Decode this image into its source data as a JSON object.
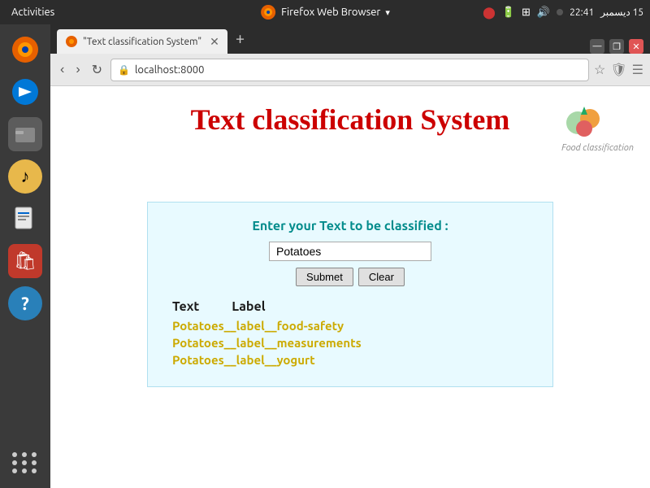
{
  "taskbar": {
    "activities_label": "Activities",
    "browser_label": "Firefox Web Browser",
    "time": "22:41",
    "date": "15 دیسمبر"
  },
  "browser": {
    "tab_title": "\"Text classification System\"",
    "url": "localhost:8000",
    "new_tab_label": "+",
    "minimize_label": "—",
    "maximize_label": "❐",
    "close_label": "✕"
  },
  "nav": {
    "back": "‹",
    "forward": "›",
    "reload": "↻"
  },
  "page": {
    "title": "Text classification System",
    "food_logo_text": "Food classification",
    "classify_prompt": "Enter your Text to be classified :",
    "input_value": "Potatoes",
    "submit_label": "Submet",
    "clear_label": "Clear",
    "col_text": "Text",
    "col_label": "Label",
    "results": [
      "Potatoes__label__food-safety",
      "Potatoes__label__measurements",
      "Potatoes__label__yogurt"
    ]
  },
  "sidebar": {
    "icons": [
      {
        "name": "firefox-icon",
        "symbol": "🦊"
      },
      {
        "name": "thunderbird-icon",
        "symbol": "🐦"
      },
      {
        "name": "files-icon",
        "symbol": "🗂"
      },
      {
        "name": "rhythmbox-icon",
        "symbol": "♪"
      },
      {
        "name": "writer-icon",
        "symbol": "📄"
      },
      {
        "name": "appstore-icon",
        "symbol": "🛍"
      },
      {
        "name": "help-icon",
        "symbol": "?"
      },
      {
        "name": "apps-icon",
        "symbol": "⋯"
      }
    ]
  }
}
